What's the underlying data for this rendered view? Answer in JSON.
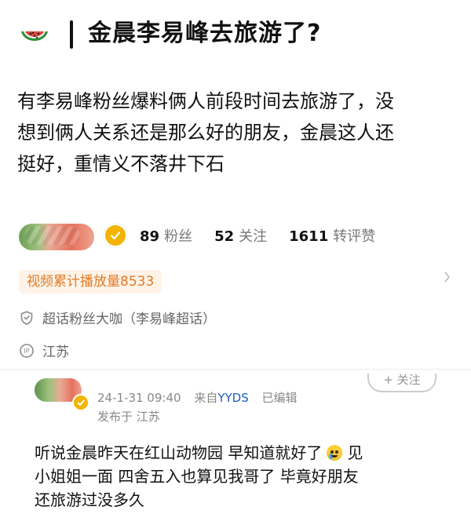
{
  "header": {
    "title": "金晨李易峰去旅游了?",
    "icon": "watermelon-icon"
  },
  "post": {
    "body_line_1": "有李易峰粉丝爆料俩人前段时间去旅游了，没",
    "body_line_2": "想到俩人关系还是那么好的朋友，金晨这人还",
    "body_line_3": "挺好，重情义不落井下石"
  },
  "author": {
    "stats": [
      {
        "num": "89",
        "label": "粉丝"
      },
      {
        "num": "52",
        "label": "关注"
      },
      {
        "num": "1611",
        "label": "转评赞"
      }
    ],
    "views_chip": "视频累计播放量8533",
    "tag_line": "超话粉丝大咖（李易峰超话）",
    "ip_line": "江苏",
    "badge": "v-badge-icon",
    "colors": {
      "badge": "#f3b400",
      "chip_text": "#e07a25",
      "chip_bg": "#fff3e8",
      "link": "#1d5fbf"
    }
  },
  "comment": {
    "datetime": "24-1-31 09:40",
    "from": "来自",
    "source": "YYDS",
    "edited": "已编辑",
    "posted_from": "发布于 江苏",
    "line_1_pre": "听说金晨昨天在红山动物园 早知道就好了",
    "line_1_post": "见",
    "line_2": "小姐姐一面  四舍五入也算见我哥了  毕竟好朋友",
    "line_3": "还旅游过没多久",
    "emoji": "crying-face-emoji-icon",
    "follow_label": "+ 关注"
  }
}
